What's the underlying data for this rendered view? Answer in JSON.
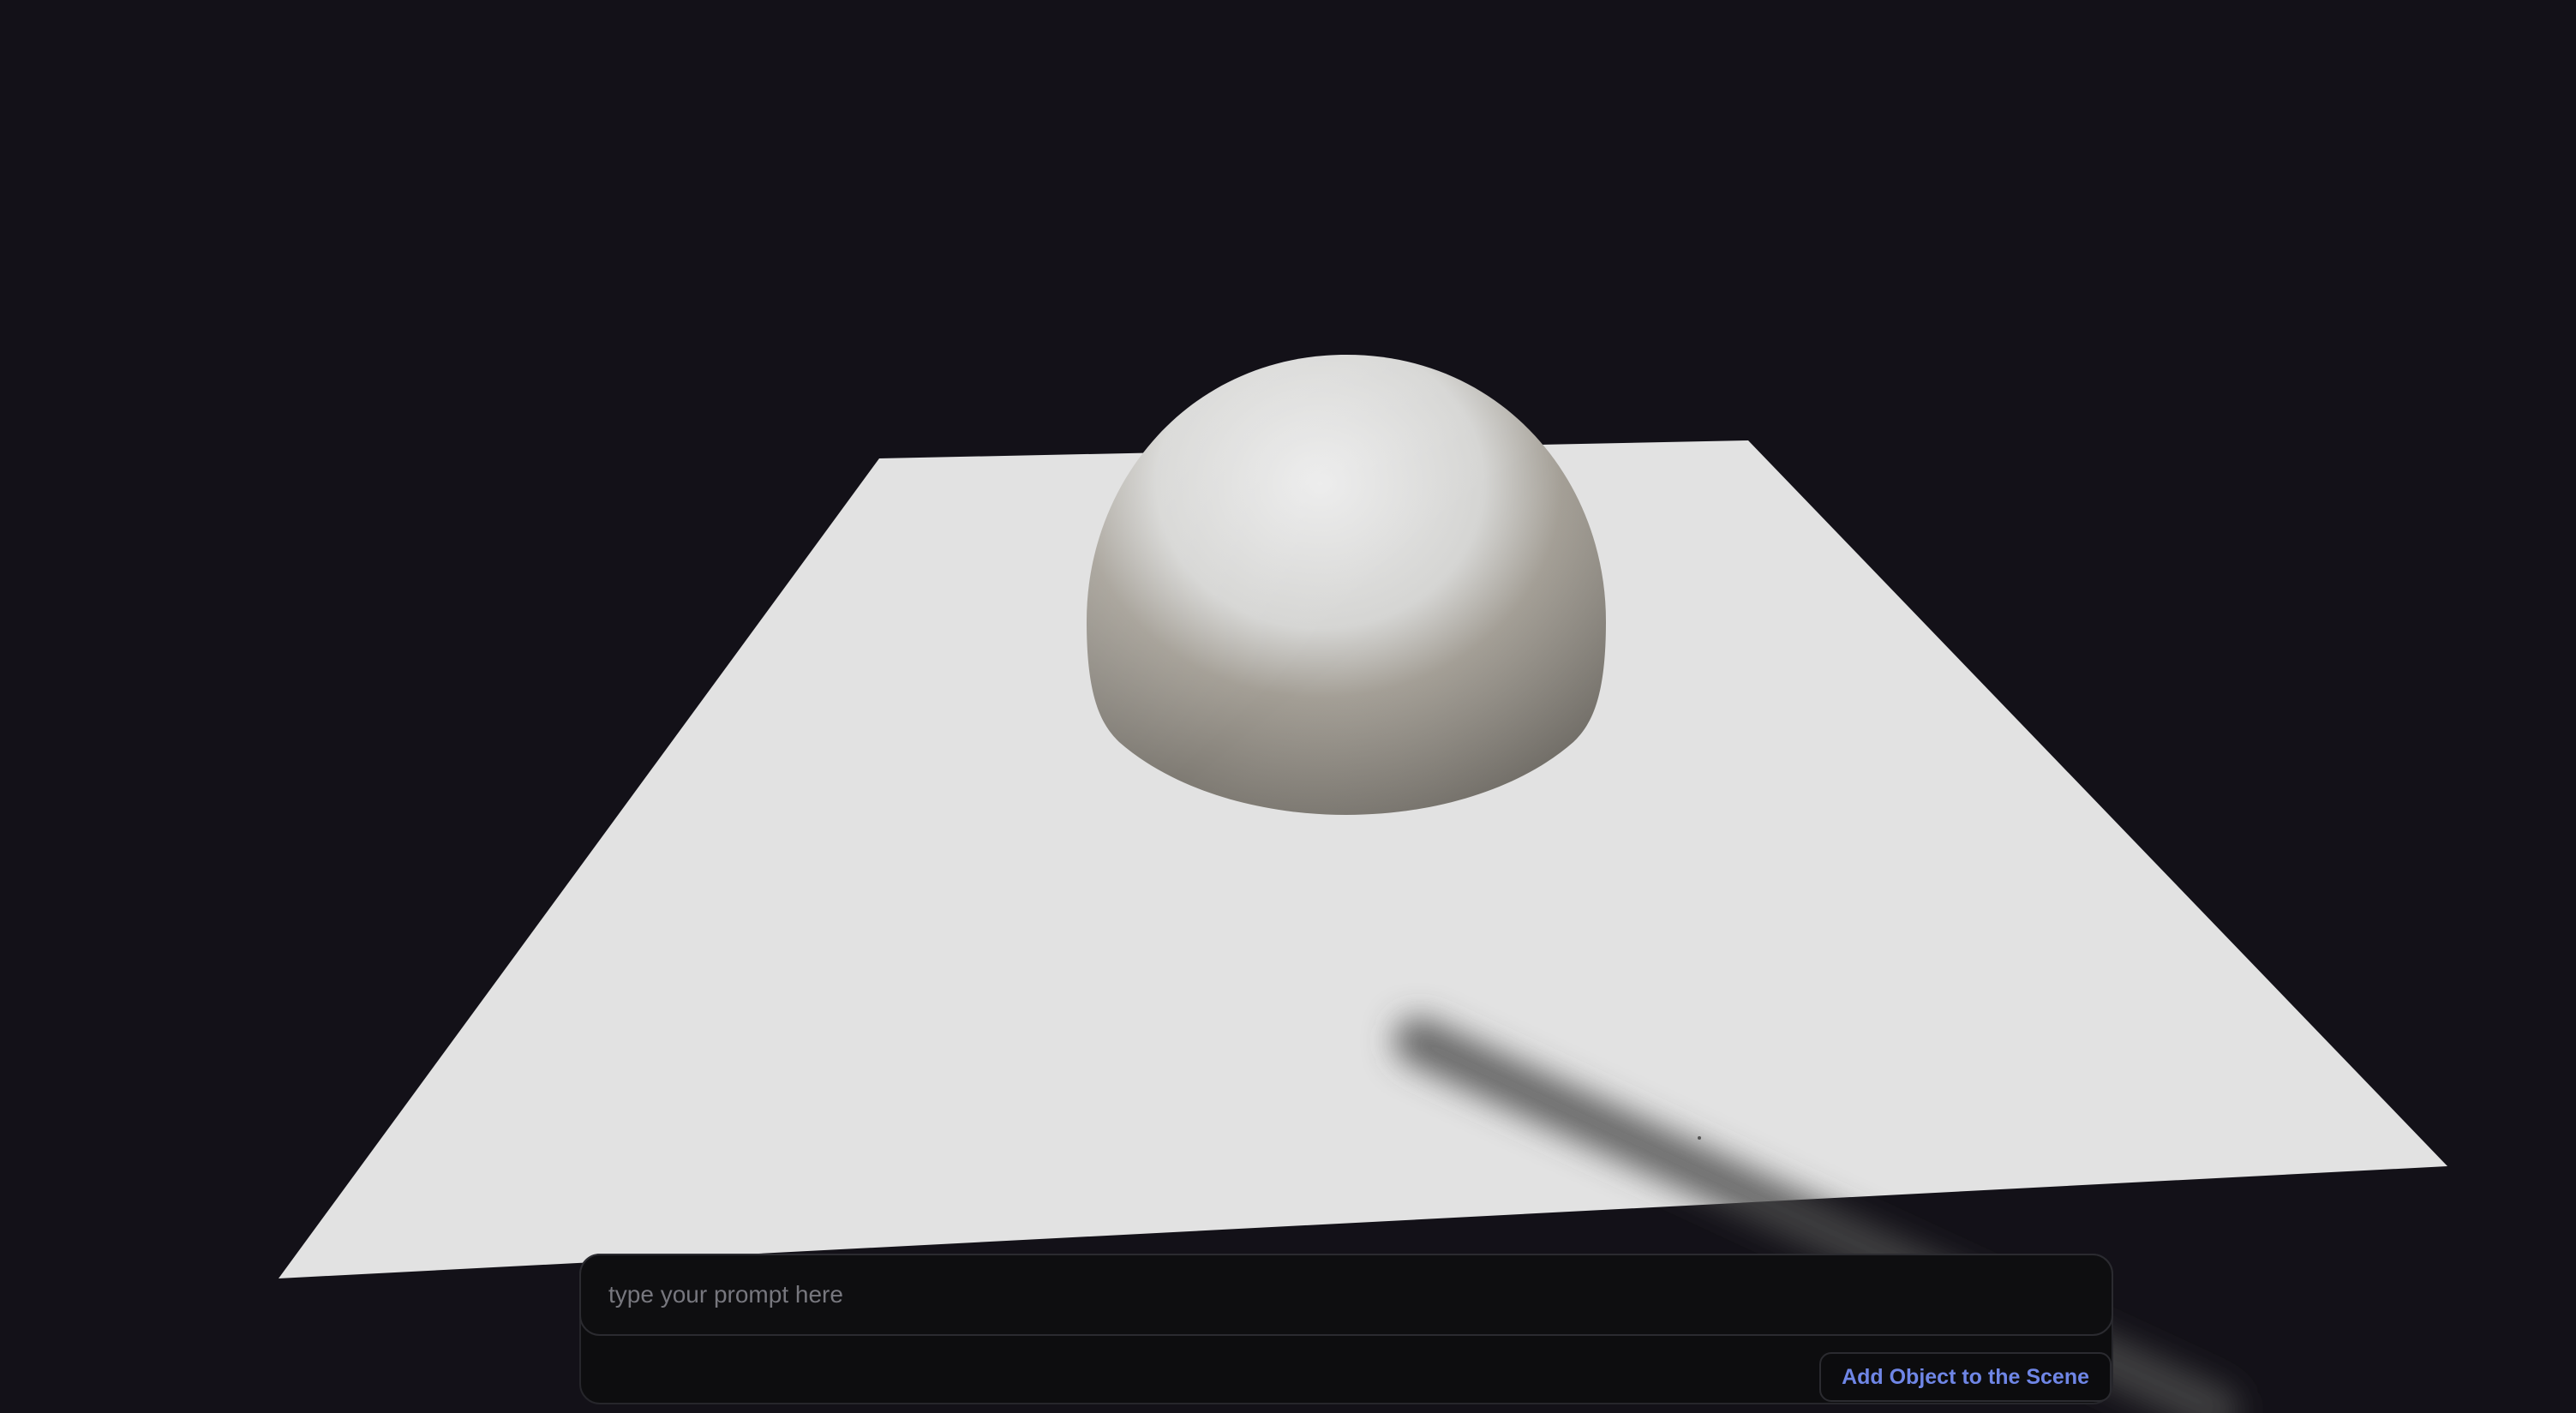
{
  "prompt": {
    "placeholder": "type your prompt here",
    "value": ""
  },
  "actions": {
    "add_object_label": "Add Object to the Scene"
  },
  "colors": {
    "background": "#131118",
    "plane": "#e2e2e2",
    "sphere": "#d9d8d4",
    "accent": "#6f86e6",
    "panel": "#0d0d0f"
  }
}
